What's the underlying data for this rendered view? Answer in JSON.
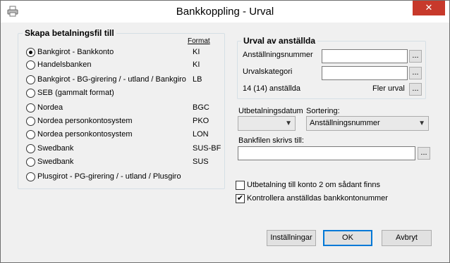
{
  "window": {
    "title": "Bankkoppling - Urval",
    "close_symbol": "✕",
    "app_icon": "printer-icon"
  },
  "payment_file": {
    "title": "Skapa betalningsfil till",
    "format_header": "Format",
    "options": [
      {
        "label": "Bankgirot - Bankkonto",
        "code": "KI",
        "selected": true
      },
      {
        "label": "Handelsbanken",
        "code": "KI",
        "selected": false
      },
      {
        "label": "Bankgirot - BG-girering / - utland / Bankgiro",
        "code": "LB",
        "selected": false
      },
      {
        "label": "SEB (gammalt format)",
        "code": "",
        "selected": false
      },
      {
        "label": "Nordea",
        "code": "BGC",
        "selected": false
      },
      {
        "label": "Nordea personkontosystem",
        "code": "PKO",
        "selected": false
      },
      {
        "label": "Nordea personkontosystem",
        "code": "LON",
        "selected": false
      },
      {
        "label": "Swedbank",
        "code": "SUS-BF",
        "selected": false
      },
      {
        "label": "Swedbank",
        "code": "SUS",
        "selected": false
      },
      {
        "label": "Plusgirot - PG-girering / - utland / Plusgiro",
        "code": "",
        "selected": false
      }
    ]
  },
  "employee_selection": {
    "title": "Urval av anställda",
    "employee_number_label": "Anställningsnummer",
    "employee_number_value": "",
    "salary_category_label": "Urvalskategori",
    "salary_category_value": "",
    "count_text": "14 (14) anställda",
    "more_selection_label": "Fler urval",
    "browse_label": "..."
  },
  "payout_date": {
    "label": "Utbetalningsdatum",
    "value": ""
  },
  "sorting": {
    "label": "Sortering:",
    "value": "Anställningsnummer"
  },
  "bank_file": {
    "label": "Bankfilen skrivs till:",
    "value": "",
    "browse_label": "..."
  },
  "checkboxes": {
    "account2": {
      "label": "Utbetalning till konto 2 om sådant finns",
      "checked": false
    },
    "verify": {
      "label": "Kontrollera anställdas bankkontonummer",
      "checked": true,
      "mark": "✔"
    }
  },
  "buttons": {
    "settings": "Inställningar",
    "ok": "OK",
    "cancel": "Avbryt"
  }
}
